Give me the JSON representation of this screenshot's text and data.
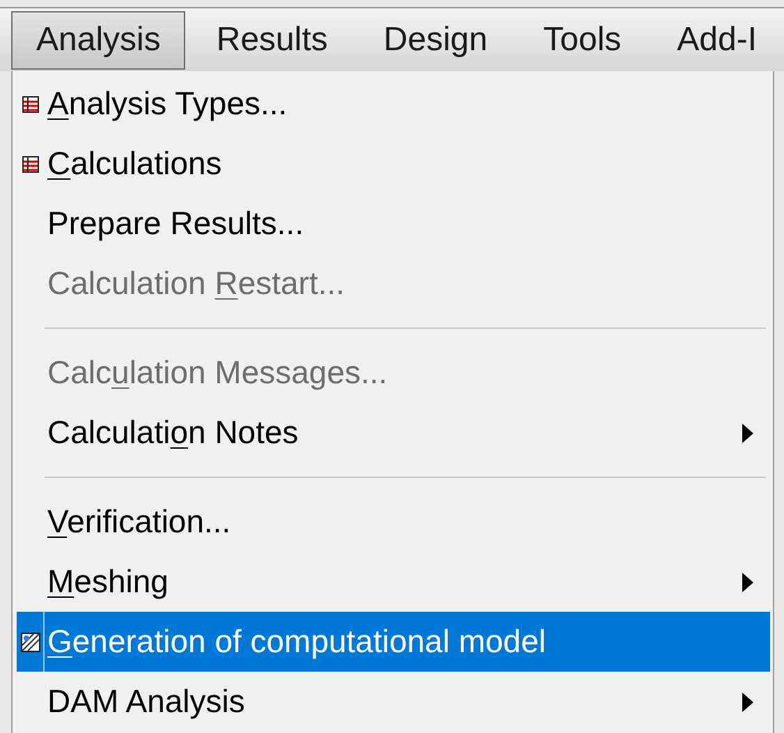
{
  "menubar": [
    {
      "label": "Analysis",
      "selected": true
    },
    {
      "label": "Results",
      "selected": false
    },
    {
      "label": "Design",
      "selected": false
    },
    {
      "label": "Tools",
      "selected": false
    },
    {
      "label": "Add-I",
      "selected": false
    }
  ],
  "menu": {
    "items": [
      {
        "kind": "table",
        "key": "A",
        "suffix": "nalysis Types...",
        "disabled": false,
        "submenu": false,
        "selected": false
      },
      {
        "kind": "table",
        "key": "C",
        "suffix": "alculations",
        "disabled": false,
        "submenu": false,
        "selected": false
      },
      {
        "kind": "plain",
        "prefix": "Prepare Results...",
        "disabled": false,
        "submenu": false,
        "selected": false
      },
      {
        "kind": "plain",
        "prefix": "Calculation ",
        "key": "R",
        "suffix": "estart...",
        "disabled": true,
        "submenu": false,
        "selected": false
      },
      {
        "kind": "separator"
      },
      {
        "kind": "plain",
        "prefix": "Calc",
        "key": "u",
        "suffix": "lation Messages...",
        "disabled": true,
        "submenu": false,
        "selected": false
      },
      {
        "kind": "plain",
        "prefix": "Calculati",
        "key": "o",
        "suffix": "n Notes",
        "disabled": false,
        "submenu": true,
        "selected": false
      },
      {
        "kind": "separator"
      },
      {
        "kind": "plain",
        "key": "V",
        "suffix": "erification...",
        "disabled": false,
        "submenu": false,
        "selected": false
      },
      {
        "kind": "plain",
        "key": "M",
        "suffix": "eshing",
        "disabled": false,
        "submenu": true,
        "selected": false
      },
      {
        "kind": "model",
        "key": "G",
        "suffix": "eneration of computational model",
        "disabled": false,
        "submenu": false,
        "selected": true
      },
      {
        "kind": "plain",
        "prefix": "DAM Analysis",
        "disabled": false,
        "submenu": true,
        "selected": false
      }
    ]
  }
}
